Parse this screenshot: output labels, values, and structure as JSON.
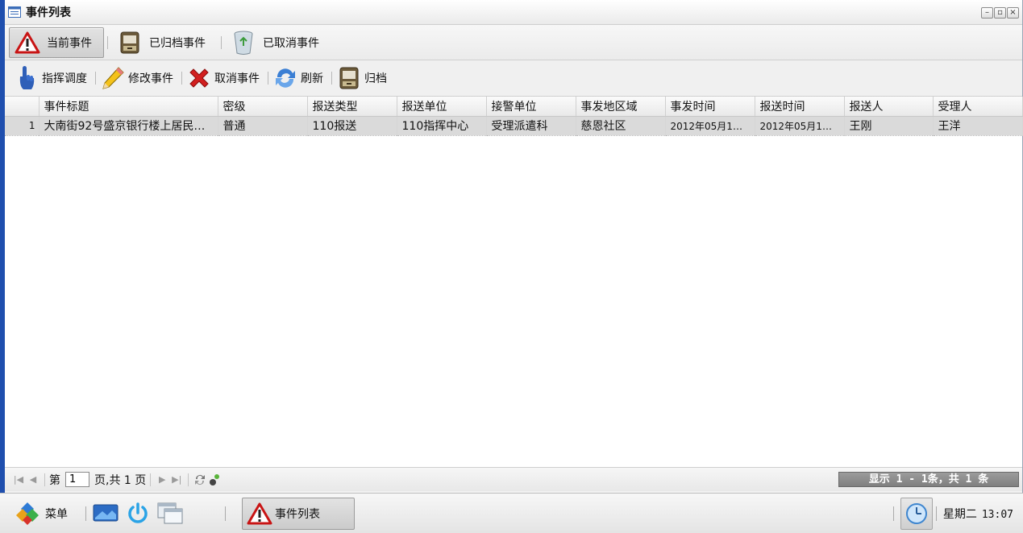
{
  "window": {
    "title": "事件列表"
  },
  "tabs": [
    {
      "label": "当前事件",
      "icon": "warning-icon",
      "active": true
    },
    {
      "label": "已归档事件",
      "icon": "archive-cabinet-icon",
      "active": false
    },
    {
      "label": "已取消事件",
      "icon": "recycle-bin-icon",
      "active": false
    }
  ],
  "toolbar": [
    {
      "label": "指挥调度",
      "icon": "pointing-hand-icon"
    },
    {
      "label": "修改事件",
      "icon": "pencil-icon"
    },
    {
      "label": "取消事件",
      "icon": "red-x-icon"
    },
    {
      "label": "刷新",
      "icon": "refresh-icon"
    },
    {
      "label": "归档",
      "icon": "archive-cabinet-icon"
    }
  ],
  "grid": {
    "columns": [
      "事件标题",
      "密级",
      "报送类型",
      "报送单位",
      "接警单位",
      "事发地区域",
      "事发时间",
      "报送时间",
      "报送人",
      "受理人"
    ],
    "rows": [
      {
        "num": "1",
        "cells": [
          "大南街92号盛京银行楼上居民…",
          "普通",
          "110报送",
          "110指挥中心",
          "受理派遣科",
          "慈恩社区",
          "2012年05月1…",
          "2012年05月1…",
          "王刚",
          "王洋"
        ]
      }
    ]
  },
  "pager": {
    "page_prefix": "第",
    "page_value": "1",
    "page_suffix": "页,共 1 页",
    "info": "显示 1 - 1条，共 1 条"
  },
  "taskbar": {
    "start_label": "菜单",
    "task_label": "事件列表",
    "weekday": "星期二",
    "time": "13:07"
  },
  "colors": {
    "window_border": "#1f4fae",
    "selected_row": "#dadada",
    "pager_info_bg": "#8a8a8a"
  }
}
